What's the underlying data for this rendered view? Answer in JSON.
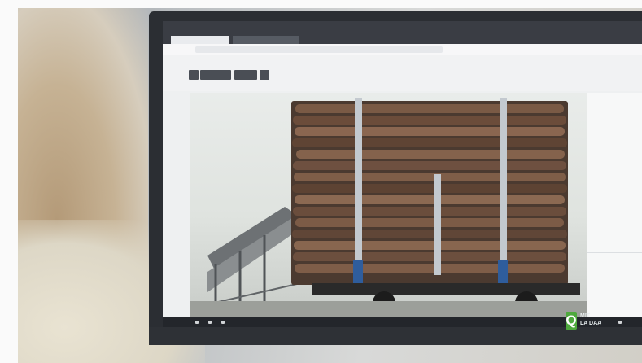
{
  "browser": {
    "app_title": "",
    "tabs": [
      {
        "label": ""
      },
      {
        "label": ""
      }
    ],
    "url": ""
  },
  "toolbar": {
    "buttons": [
      "",
      "",
      "",
      ""
    ],
    "title": "",
    "right_items": [
      "",
      "",
      ""
    ]
  },
  "photo": {
    "subject": "log-truck-load"
  },
  "sidebar": {
    "items": [
      "",
      "",
      "",
      "",
      "",
      "",
      "",
      "",
      "",
      "",
      ""
    ]
  },
  "watermark": {
    "logo_letter": "Q",
    "line1": "MIT",
    "line2": "LA DAA"
  },
  "colors": {
    "stake_base": "#2f5d9c",
    "watermark_green": "#4ea93d",
    "titlebar": "#3a3d44"
  }
}
